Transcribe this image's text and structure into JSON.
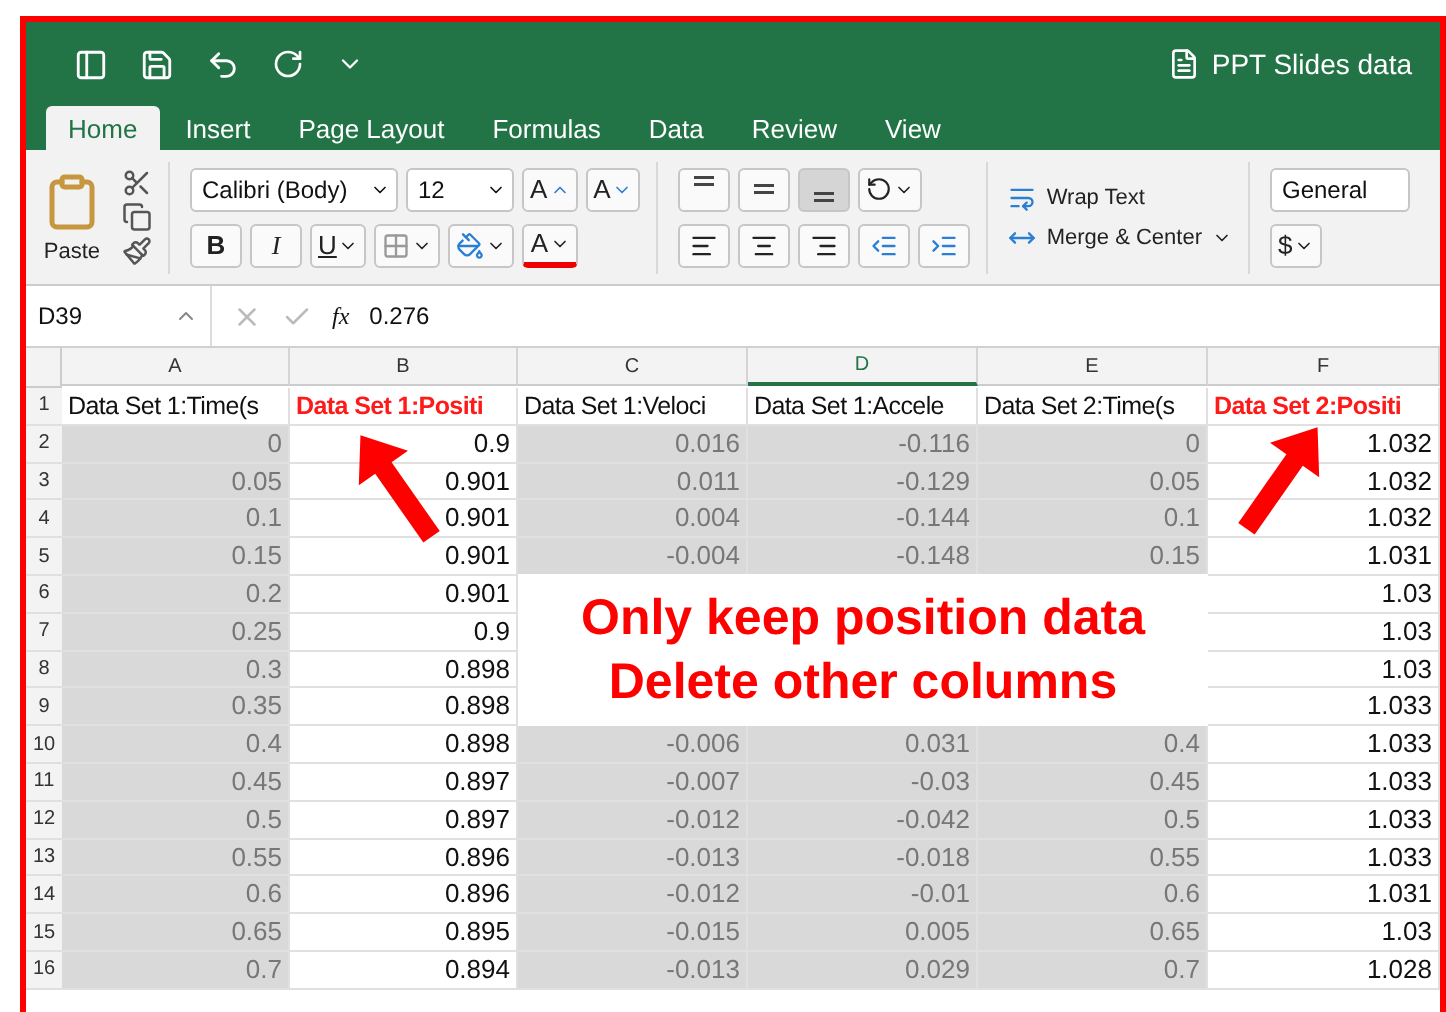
{
  "window": {
    "title": "PPT Slides data"
  },
  "tabs": [
    {
      "label": "Home",
      "selected": true
    },
    {
      "label": "Insert",
      "selected": false
    },
    {
      "label": "Page Layout",
      "selected": false
    },
    {
      "label": "Formulas",
      "selected": false
    },
    {
      "label": "Data",
      "selected": false
    },
    {
      "label": "Review",
      "selected": false
    },
    {
      "label": "View",
      "selected": false
    }
  ],
  "ribbon": {
    "paste_label": "Paste",
    "font_name": "Calibri (Body)",
    "font_size": "12",
    "grow_font": "A",
    "shrink_font": "A",
    "bold": "B",
    "italic": "I",
    "underline": "U",
    "font_color_letter": "A",
    "vertical_align": [
      {
        "selected": false
      },
      {
        "selected": false
      },
      {
        "selected": true
      }
    ],
    "wrap_text": "Wrap Text",
    "merge_center": "Merge & Center",
    "number_format": "General",
    "currency": "$"
  },
  "formula_bar": {
    "cell_ref": "D39",
    "fx": "fx",
    "value": "0.276"
  },
  "columns": [
    {
      "letter": "A",
      "active": false,
      "shaded": true
    },
    {
      "letter": "B",
      "active": false,
      "shaded": false
    },
    {
      "letter": "C",
      "active": false,
      "shaded": true
    },
    {
      "letter": "D",
      "active": true,
      "shaded": true
    },
    {
      "letter": "E",
      "active": false,
      "shaded": true
    },
    {
      "letter": "F",
      "active": false,
      "shaded": false
    }
  ],
  "rows": [
    {
      "number": "1",
      "kind": "header",
      "cells": [
        {
          "text": "Data Set 1:Time(s",
          "emphasis": false
        },
        {
          "text": "Data Set 1:Positi",
          "emphasis": true
        },
        {
          "text": "Data Set 1:Veloci",
          "emphasis": false
        },
        {
          "text": "Data Set 1:Accele",
          "emphasis": false
        },
        {
          "text": "Data Set 2:Time(s",
          "emphasis": false
        },
        {
          "text": "Data Set 2:Positi",
          "emphasis": true
        }
      ]
    },
    {
      "number": "2",
      "kind": "data",
      "cells": [
        "0",
        "0.9",
        "0.016",
        "-0.116",
        "0",
        "1.032"
      ]
    },
    {
      "number": "3",
      "kind": "data",
      "cells": [
        "0.05",
        "0.901",
        "0.011",
        "-0.129",
        "0.05",
        "1.032"
      ]
    },
    {
      "number": "4",
      "kind": "data",
      "cells": [
        "0.1",
        "0.901",
        "0.004",
        "-0.144",
        "0.1",
        "1.032"
      ]
    },
    {
      "number": "5",
      "kind": "data",
      "cells": [
        "0.15",
        "0.901",
        "-0.004",
        "-0.148",
        "0.15",
        "1.031"
      ]
    },
    {
      "number": "6",
      "kind": "data",
      "cells": [
        "0.2",
        "0.901",
        null,
        null,
        null,
        "1.03"
      ]
    },
    {
      "number": "7",
      "kind": "data",
      "cells": [
        "0.25",
        "0.9",
        null,
        null,
        null,
        "1.03"
      ]
    },
    {
      "number": "8",
      "kind": "data",
      "cells": [
        "0.3",
        "0.898",
        null,
        null,
        null,
        "1.03"
      ]
    },
    {
      "number": "9",
      "kind": "data",
      "cells": [
        "0.35",
        "0.898",
        null,
        null,
        null,
        "1.033"
      ]
    },
    {
      "number": "10",
      "kind": "data",
      "cells": [
        "0.4",
        "0.898",
        "-0.006",
        "0.031",
        "0.4",
        "1.033"
      ]
    },
    {
      "number": "11",
      "kind": "data",
      "cells": [
        "0.45",
        "0.897",
        "-0.007",
        "-0.03",
        "0.45",
        "1.033"
      ]
    },
    {
      "number": "12",
      "kind": "data",
      "cells": [
        "0.5",
        "0.897",
        "-0.012",
        "-0.042",
        "0.5",
        "1.033"
      ]
    },
    {
      "number": "13",
      "kind": "data",
      "cells": [
        "0.55",
        "0.896",
        "-0.013",
        "-0.018",
        "0.55",
        "1.033"
      ]
    },
    {
      "number": "14",
      "kind": "data",
      "cells": [
        "0.6",
        "0.896",
        "-0.012",
        "-0.01",
        "0.6",
        "1.031"
      ]
    },
    {
      "number": "15",
      "kind": "data",
      "cells": [
        "0.65",
        "0.895",
        "-0.015",
        "0.005",
        "0.65",
        "1.03"
      ]
    },
    {
      "number": "16",
      "kind": "data",
      "cells": [
        "0.7",
        "0.894",
        "-0.013",
        "0.029",
        "0.7",
        "1.028"
      ]
    }
  ],
  "callout": {
    "lines": [
      "Only keep position data",
      "Delete other columns"
    ]
  }
}
